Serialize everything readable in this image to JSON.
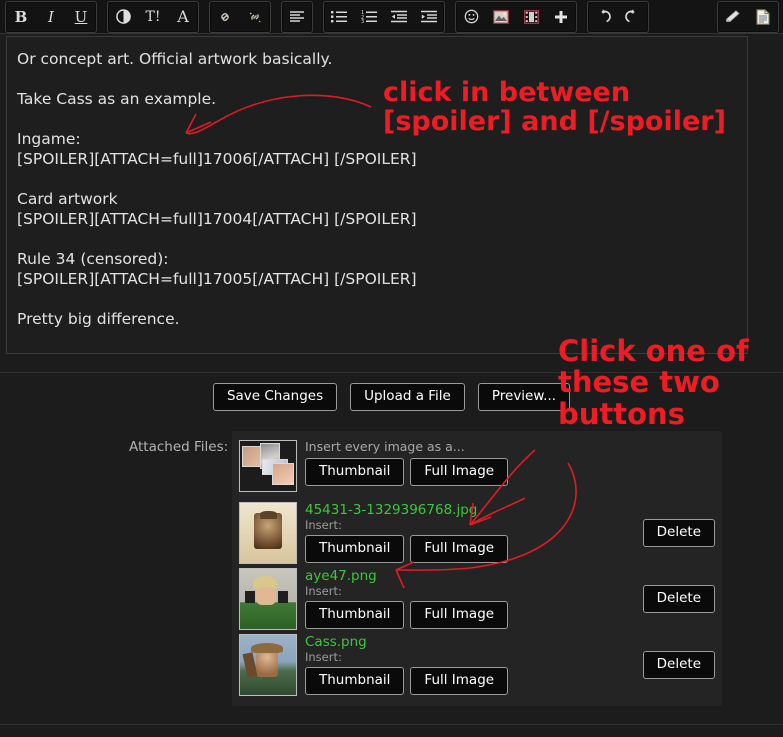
{
  "toolbar": {
    "groups": [
      {
        "name": "format",
        "buttons": [
          {
            "name": "bold-icon",
            "label": "B"
          },
          {
            "name": "italic-icon",
            "label": "I"
          },
          {
            "name": "underline-icon",
            "label": "U"
          }
        ]
      },
      {
        "name": "style",
        "buttons": [
          {
            "name": "text-color-icon",
            "label": "◐"
          },
          {
            "name": "font-size-icon",
            "label": "T!"
          },
          {
            "name": "font-family-icon",
            "label": "A"
          }
        ]
      },
      {
        "name": "link",
        "buttons": [
          {
            "name": "link-icon",
            "label": "🔗"
          },
          {
            "name": "unlink-icon",
            "label": "⛓"
          }
        ]
      },
      {
        "name": "align",
        "buttons": [
          {
            "name": "align-left-icon",
            "label": "≣"
          }
        ]
      },
      {
        "name": "lists",
        "buttons": [
          {
            "name": "bullet-list-icon",
            "label": "☰"
          },
          {
            "name": "numbered-list-icon",
            "label": "☰"
          },
          {
            "name": "outdent-icon",
            "label": "☰"
          },
          {
            "name": "indent-icon",
            "label": "☰"
          }
        ]
      },
      {
        "name": "media",
        "buttons": [
          {
            "name": "smiley-icon",
            "label": "☺"
          },
          {
            "name": "insert-image-icon",
            "label": "▣"
          },
          {
            "name": "insert-video-icon",
            "label": "▤"
          },
          {
            "name": "more-options-icon",
            "label": "+"
          }
        ]
      },
      {
        "name": "history",
        "buttons": [
          {
            "name": "undo-icon",
            "label": "↺"
          },
          {
            "name": "redo-icon",
            "label": "↻"
          }
        ]
      },
      {
        "name": "tools",
        "buttons": [
          {
            "name": "remove-formatting-icon",
            "label": "▰"
          },
          {
            "name": "source-view-icon",
            "label": "📄"
          }
        ]
      }
    ]
  },
  "editor": {
    "lines": [
      "Or concept art. Official artwork basically.",
      "",
      "Take Cass as an example.",
      "",
      "Ingame:",
      "[SPOILER][ATTACH=full]17006[/ATTACH] [/SPOILER]",
      "",
      "Card artwork",
      "[SPOILER][ATTACH=full]17004[/ATTACH] [/SPOILER]",
      "",
      "Rule 34 (censored):",
      "[SPOILER][ATTACH=full]17005[/ATTACH] [/SPOILER]",
      "",
      "Pretty big difference."
    ]
  },
  "annotations": {
    "first": "click in between\n[spoiler] and [/spoiler]",
    "second": "Click one of\nthese two\nbuttons",
    "color": "#ee1c24"
  },
  "actions": {
    "save": "Save Changes",
    "upload": "Upload a File",
    "preview": "Preview..."
  },
  "attachments": {
    "label": "Attached Files:",
    "rows": [
      {
        "filename": "",
        "insert_label": "Insert every image as a...",
        "thumbnail_button": "Thumbnail",
        "full_image_button": "Full Image",
        "delete_button": "",
        "has_delete": false,
        "thumb_kind": "collage"
      },
      {
        "filename": "45431-3-1329396768.jpg",
        "insert_label": "Insert:",
        "thumbnail_button": "Thumbnail",
        "full_image_button": "Full Image",
        "delete_button": "Delete",
        "has_delete": true,
        "thumb_kind": "card"
      },
      {
        "filename": "aye47.png",
        "insert_label": "Insert:",
        "thumbnail_button": "Thumbnail",
        "full_image_button": "Full Image",
        "delete_button": "Delete",
        "has_delete": true,
        "thumb_kind": "aye"
      },
      {
        "filename": "Cass.png",
        "insert_label": "Insert:",
        "thumbnail_button": "Thumbnail",
        "full_image_button": "Full Image",
        "delete_button": "Delete",
        "has_delete": true,
        "thumb_kind": "cass"
      }
    ]
  },
  "colors": {
    "filename_green": "#3ec63e",
    "annotation_red": "#ee1c24",
    "editor_bg": "#1e1e1e",
    "page_bg": "#1c1c1c"
  }
}
